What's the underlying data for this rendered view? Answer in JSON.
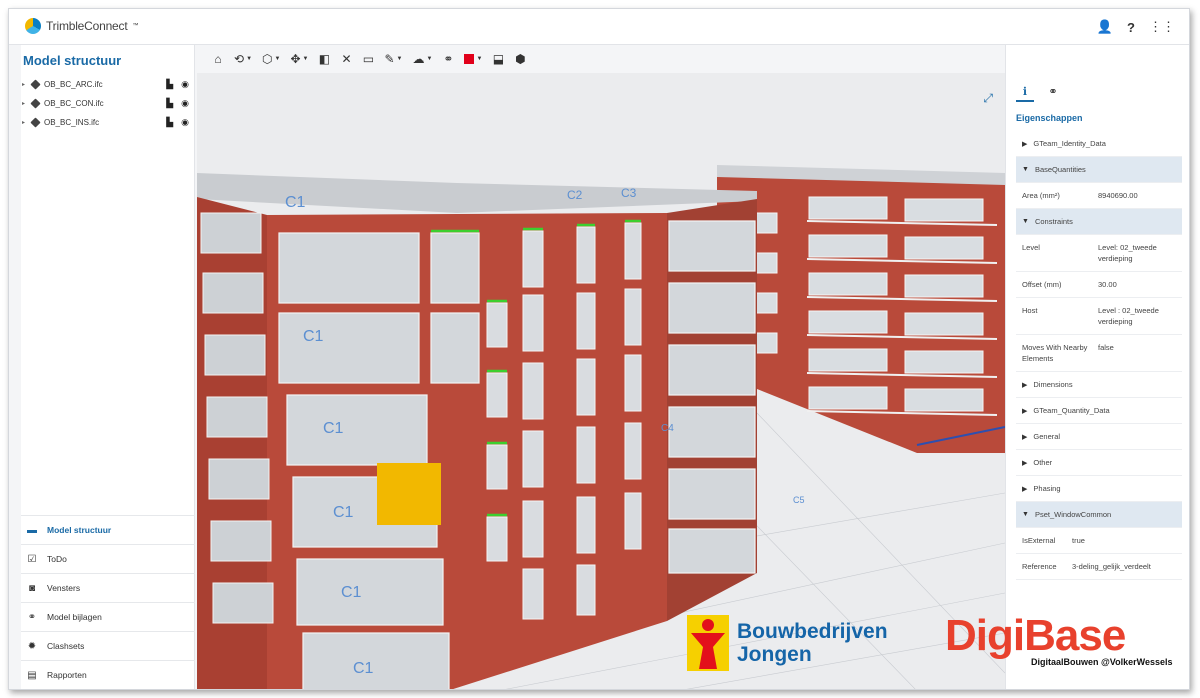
{
  "app": {
    "brand": "TrimbleConnect",
    "brand_mark": "™"
  },
  "header_icons": [
    {
      "name": "user-icon",
      "glyph": "👤"
    },
    {
      "name": "help-icon",
      "glyph": "?"
    },
    {
      "name": "apps-grid-icon",
      "glyph": "⋮⋮"
    }
  ],
  "left_panel": {
    "title": "Model structuur",
    "models": [
      {
        "label": "OB_BC_ARC.ifc"
      },
      {
        "label": "OB_BC_CON.ifc"
      },
      {
        "label": "OB_BC_INS.ifc"
      }
    ],
    "nav": [
      {
        "label": "Model structuur",
        "icon": "folder-icon",
        "glyph": "▬",
        "active": true
      },
      {
        "label": "ToDo",
        "icon": "todo-icon",
        "glyph": "☑",
        "active": false
      },
      {
        "label": "Vensters",
        "icon": "camera-icon",
        "glyph": "◙",
        "active": false
      },
      {
        "label": "Model bijlagen",
        "icon": "link-icon",
        "glyph": "⚭",
        "active": false
      },
      {
        "label": "Clashsets",
        "icon": "clash-icon",
        "glyph": "✹",
        "active": false
      },
      {
        "label": "Rapporten",
        "icon": "report-icon",
        "glyph": "▤",
        "active": false
      }
    ]
  },
  "toolbar": [
    {
      "name": "home-view-icon",
      "glyph": "⌂",
      "caret": false
    },
    {
      "name": "orbit-icon",
      "glyph": "⟲",
      "caret": true
    },
    {
      "name": "view-cube-icon",
      "glyph": "⬡",
      "caret": true
    },
    {
      "name": "navigate-icon",
      "glyph": "✥",
      "caret": true
    },
    {
      "name": "section-icon",
      "glyph": "◧",
      "caret": false
    },
    {
      "name": "clear-section-icon",
      "glyph": "✕",
      "caret": false
    },
    {
      "name": "measure-icon",
      "glyph": "▭",
      "caret": false
    },
    {
      "name": "pick-icon",
      "glyph": "✎",
      "caret": true
    },
    {
      "name": "markup-icon",
      "glyph": "☁",
      "caret": true
    },
    {
      "name": "link-tool-icon",
      "glyph": "⚭",
      "caret": false
    },
    {
      "name": "color-icon",
      "glyph": "",
      "caret": true,
      "swatch": "#e1001a"
    },
    {
      "name": "isolate-icon",
      "glyph": "⬓",
      "caret": false
    },
    {
      "name": "hide-icon",
      "glyph": "⬢",
      "caret": false
    }
  ],
  "right_panel": {
    "tabs": [
      {
        "name": "info-tab",
        "glyph": "ℹ",
        "active": true
      },
      {
        "name": "links-tab",
        "glyph": "⚭",
        "active": false
      }
    ],
    "title": "Eigenschappen",
    "sections": [
      {
        "label": "GTeam_Identity_Data",
        "open": false,
        "rows": []
      },
      {
        "label": "BaseQuantities",
        "open": true,
        "rows": [
          {
            "key": "Area (mm²)",
            "value": "8940690.00"
          }
        ]
      },
      {
        "label": "Constraints",
        "open": true,
        "rows": [
          {
            "key": "Level",
            "value": "Level: 02_tweede verdieping"
          },
          {
            "key": "Offset (mm)",
            "value": "30.00"
          },
          {
            "key": "Host",
            "value": "Level : 02_tweede verdieping"
          },
          {
            "key": "Moves With Nearby Elements",
            "value": "false"
          }
        ]
      },
      {
        "label": "Dimensions",
        "open": false,
        "rows": []
      },
      {
        "label": "GTeam_Quantity_Data",
        "open": false,
        "rows": []
      },
      {
        "label": "General",
        "open": false,
        "rows": []
      },
      {
        "label": "Other",
        "open": false,
        "rows": []
      },
      {
        "label": "Phasing",
        "open": false,
        "rows": []
      },
      {
        "label": "Pset_WindowCommon",
        "open": true,
        "rows": [
          {
            "key": "IsExternal",
            "value": "true"
          },
          {
            "key": "Reference",
            "value": "3-deling_gelijk_verdeelt"
          }
        ]
      }
    ]
  },
  "viewport": {
    "grid_labels": [
      "C1",
      "C1",
      "C1",
      "C1",
      "C1",
      "C1",
      "C2",
      "C3",
      "C4",
      "C5"
    ],
    "colors": {
      "brick": "#b94a3a",
      "window": "#d6dade",
      "highlight": "#f2b800",
      "green": "#3ccf2f"
    }
  },
  "watermarks": {
    "bouwbedrijven_line1": "Bouwbedrijven",
    "bouwbedrijven_line2": "Jongen",
    "digibase": "DigiBase",
    "digibase_sub": "DigitaalBouwen @VolkerWessels"
  }
}
